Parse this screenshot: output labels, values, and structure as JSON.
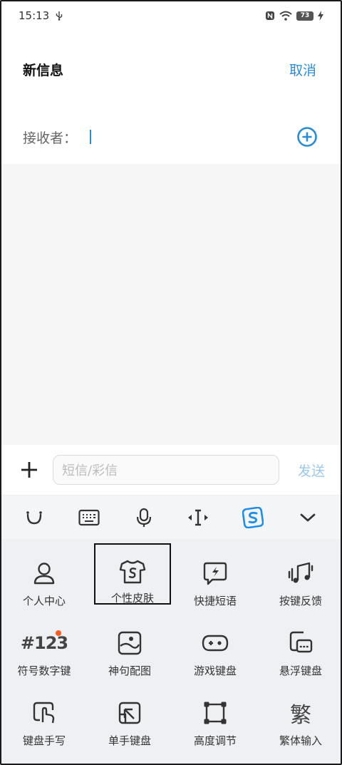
{
  "status_bar": {
    "time": "15:13",
    "battery": "73"
  },
  "header": {
    "title": "新信息",
    "cancel_label": "取消"
  },
  "recipient": {
    "label": "接收者："
  },
  "compose": {
    "placeholder": "短信/彩信",
    "send_label": "发送"
  },
  "toolbar": {
    "items": [
      {
        "icon": "emoji-icon"
      },
      {
        "icon": "keyboard-icon"
      },
      {
        "icon": "microphone-icon"
      },
      {
        "icon": "cursor-icon"
      },
      {
        "icon": "sogou-logo-icon"
      },
      {
        "icon": "chevron-down-icon"
      }
    ]
  },
  "panel": {
    "items": [
      {
        "label": "个人中心",
        "icon": "person-icon"
      },
      {
        "label": "个性皮肤",
        "icon": "tshirt-icon"
      },
      {
        "label": "快捷短语",
        "icon": "quick-phrase-icon"
      },
      {
        "label": "按键反馈",
        "icon": "music-note-icon"
      },
      {
        "label": "符号数字键",
        "icon": "symbol-number-icon",
        "icon_text": "#123"
      },
      {
        "label": "神句配图",
        "icon": "image-icon"
      },
      {
        "label": "游戏键盘",
        "icon": "gamepad-icon"
      },
      {
        "label": "悬浮键盘",
        "icon": "floating-keyboard-icon"
      },
      {
        "label": "键盘手写",
        "icon": "handwriting-icon"
      },
      {
        "label": "单手键盘",
        "icon": "one-hand-keyboard-icon"
      },
      {
        "label": "高度调节",
        "icon": "resize-icon"
      },
      {
        "label": "繁体输入",
        "icon": "traditional-chinese-icon",
        "icon_text": "繁"
      }
    ]
  },
  "colors": {
    "accent": "#2b8cd6",
    "send_disabled": "#9cc8eb",
    "badge": "#ff5b1a"
  }
}
